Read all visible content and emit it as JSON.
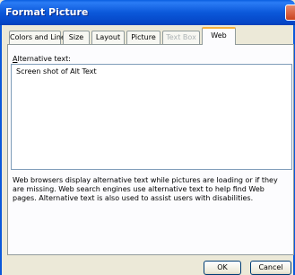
{
  "window": {
    "title": "Format Picture"
  },
  "tabs": [
    {
      "label": "Colors and Lines",
      "state": "normal"
    },
    {
      "label": "Size",
      "state": "normal"
    },
    {
      "label": "Layout",
      "state": "normal"
    },
    {
      "label": "Picture",
      "state": "normal"
    },
    {
      "label": "Text Box",
      "state": "disabled"
    },
    {
      "label": "Web",
      "state": "active"
    }
  ],
  "web": {
    "alt_text_label_accel": "A",
    "alt_text_label_rest": "lternative text:",
    "alt_text_value": "Screen shot of Alt Text",
    "description": "Web browsers display alternative text while pictures are loading or if they are missing.  Web search engines use alternative text to help find Web pages.  Alternative text is also used to assist users with disabilities."
  },
  "buttons": {
    "ok": "OK",
    "cancel": "Cancel"
  },
  "colors": {
    "title_bar": "#0b58da",
    "dialog_bg": "#ece9d8",
    "active_tab_accent": "#f7b23d",
    "close_button": "#c9431f"
  }
}
